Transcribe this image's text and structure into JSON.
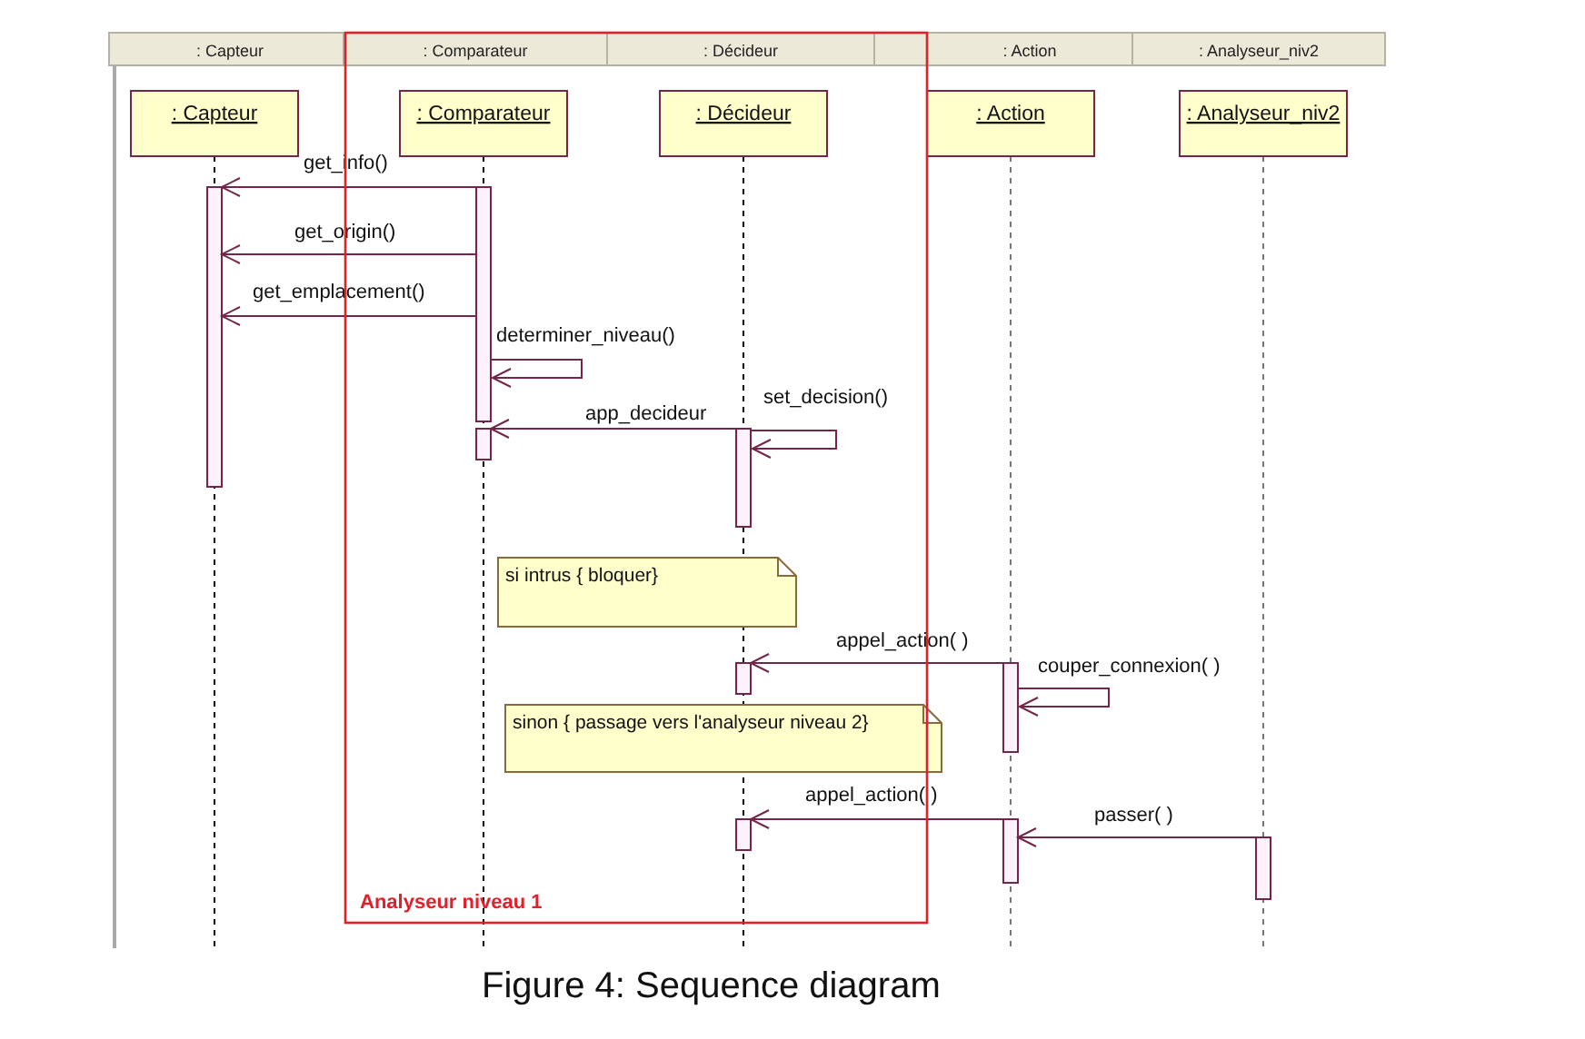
{
  "lifelines": [
    {
      "header": ": Capteur",
      "label": ": Capteur"
    },
    {
      "header": ": Comparateur",
      "label": ": Comparateur"
    },
    {
      "header": ": Décideur",
      "label": ": Décideur"
    },
    {
      "header": ": Action",
      "label": ": Action"
    },
    {
      "header": ": Analyseur_niv2",
      "label": ": Analyseur_niv2"
    }
  ],
  "messages": [
    {
      "label": "get_info()",
      "kind": "call"
    },
    {
      "label": "get_origin()",
      "kind": "call"
    },
    {
      "label": "get_emplacement()",
      "kind": "call"
    },
    {
      "label": "determiner_niveau()",
      "kind": "self"
    },
    {
      "label": "app_decideur",
      "kind": "call"
    },
    {
      "label": "set_decision()",
      "kind": "self"
    },
    {
      "label": "appel_action( )",
      "kind": "call"
    },
    {
      "label": "couper_connexion( )",
      "kind": "self"
    },
    {
      "label": "appel_action( )",
      "kind": "call"
    },
    {
      "label": "passer( )",
      "kind": "call"
    }
  ],
  "notes": [
    {
      "text": "si intrus { bloquer}"
    },
    {
      "text": "sinon { passage vers l'analyseur niveau 2}"
    }
  ],
  "frame": {
    "label": "Analyseur niveau 1"
  },
  "caption": "Figure 4: Sequence diagram"
}
